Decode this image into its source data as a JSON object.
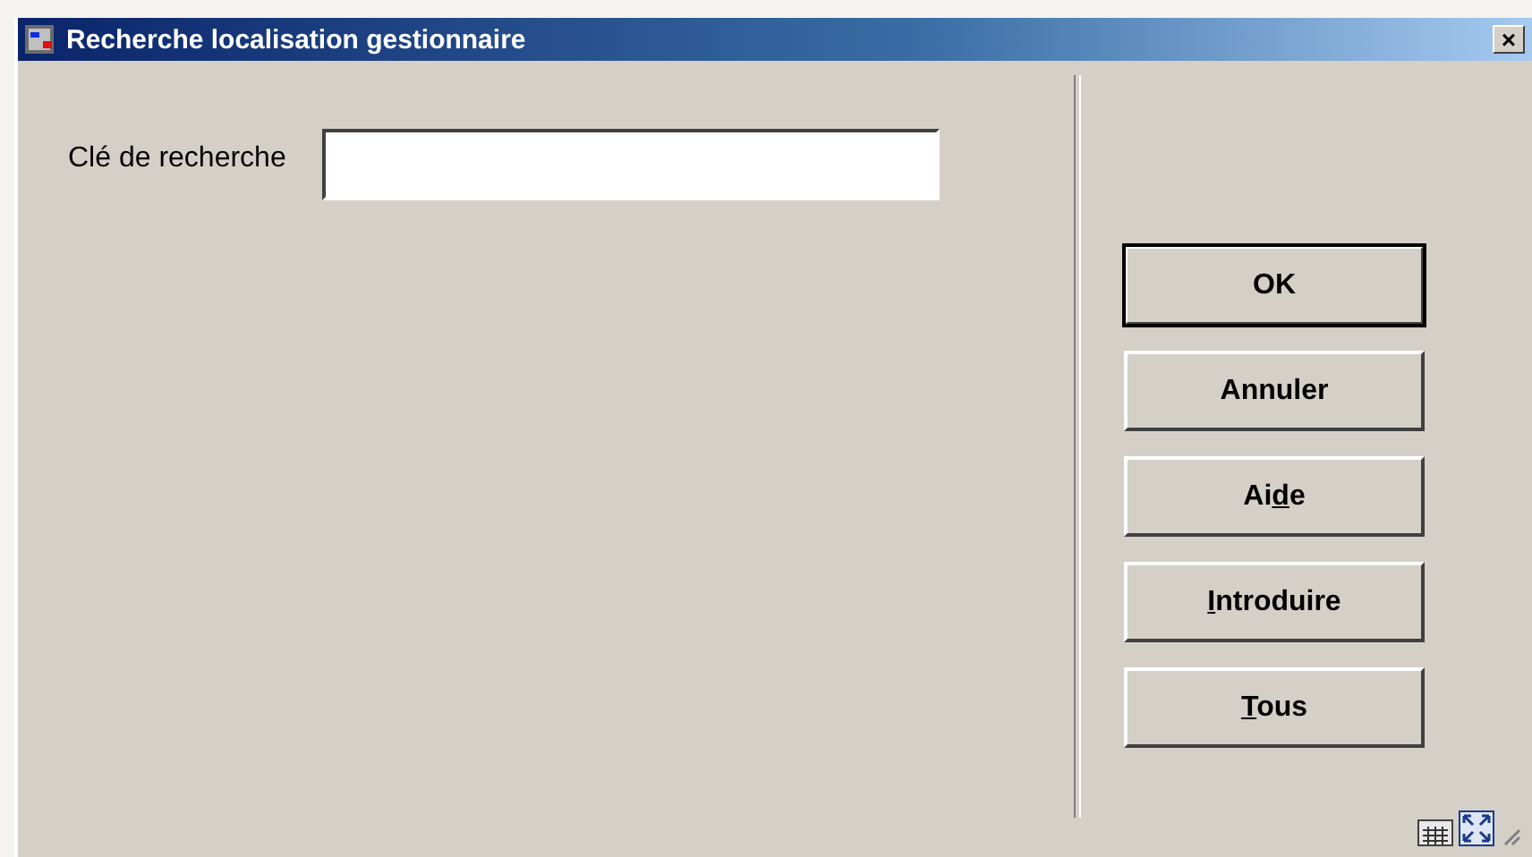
{
  "window": {
    "title": "Recherche localisation gestionnaire",
    "close": "×"
  },
  "search": {
    "label": "Clé de recherche"
  },
  "buttons": [
    {
      "parts": [
        {
          "text": "OK",
          "underlined": false
        }
      ],
      "default": true
    },
    {
      "parts": [
        {
          "text": "Annuler",
          "underlined": false
        }
      ],
      "default": false
    },
    {
      "parts": [
        {
          "text": "Ai",
          "underlined": false
        },
        {
          "text": "d",
          "underlined": true
        },
        {
          "text": "e",
          "underlined": false
        }
      ],
      "default": false
    },
    {
      "parts": [
        {
          "text": "I",
          "underlined": true
        },
        {
          "text": "ntroduire",
          "underlined": false
        }
      ],
      "default": false
    },
    {
      "parts": [
        {
          "text": "T",
          "underlined": true
        },
        {
          "text": "ous",
          "underlined": false
        }
      ],
      "default": false
    }
  ]
}
